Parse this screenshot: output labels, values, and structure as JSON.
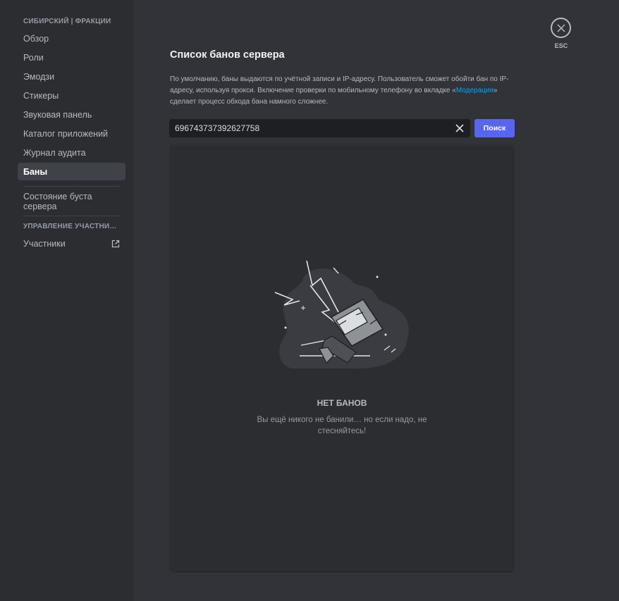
{
  "sidebar": {
    "server_header": "СИБИРСКИЙ | ФРАКЦИИ",
    "items": [
      {
        "label": "Обзор"
      },
      {
        "label": "Роли"
      },
      {
        "label": "Эмодзи"
      },
      {
        "label": "Стикеры"
      },
      {
        "label": "Звуковая панель"
      },
      {
        "label": "Каталог приложений"
      },
      {
        "label": "Журнал аудита"
      },
      {
        "label": "Баны"
      }
    ],
    "boost_label": "Состояние буста сервера",
    "members_header": "УПРАВЛЕНИЕ УЧАСТНИКА...",
    "members_label": "Участники"
  },
  "main": {
    "title": "Список банов сервера",
    "desc_before": "По умолчанию, баны выдаются по учётной записи и IP-адресу. Пользователь сможет обойти бан по IP-адресу, используя прокси. Включение проверки по мобильному телефону во вкладке «",
    "desc_link": "Модерация",
    "desc_after": "» сделает процесс обхода бана намного сложнее.",
    "search_value": "696743737392627758",
    "search_button": "Поиск",
    "empty_title": "НЕТ БАНОВ",
    "empty_desc": "Вы ещё никого не банили… но если надо, не стесняйтесь!"
  },
  "close": {
    "label": "ESC"
  },
  "colors": {
    "accent": "#5865f2",
    "link": "#00a8fc"
  }
}
